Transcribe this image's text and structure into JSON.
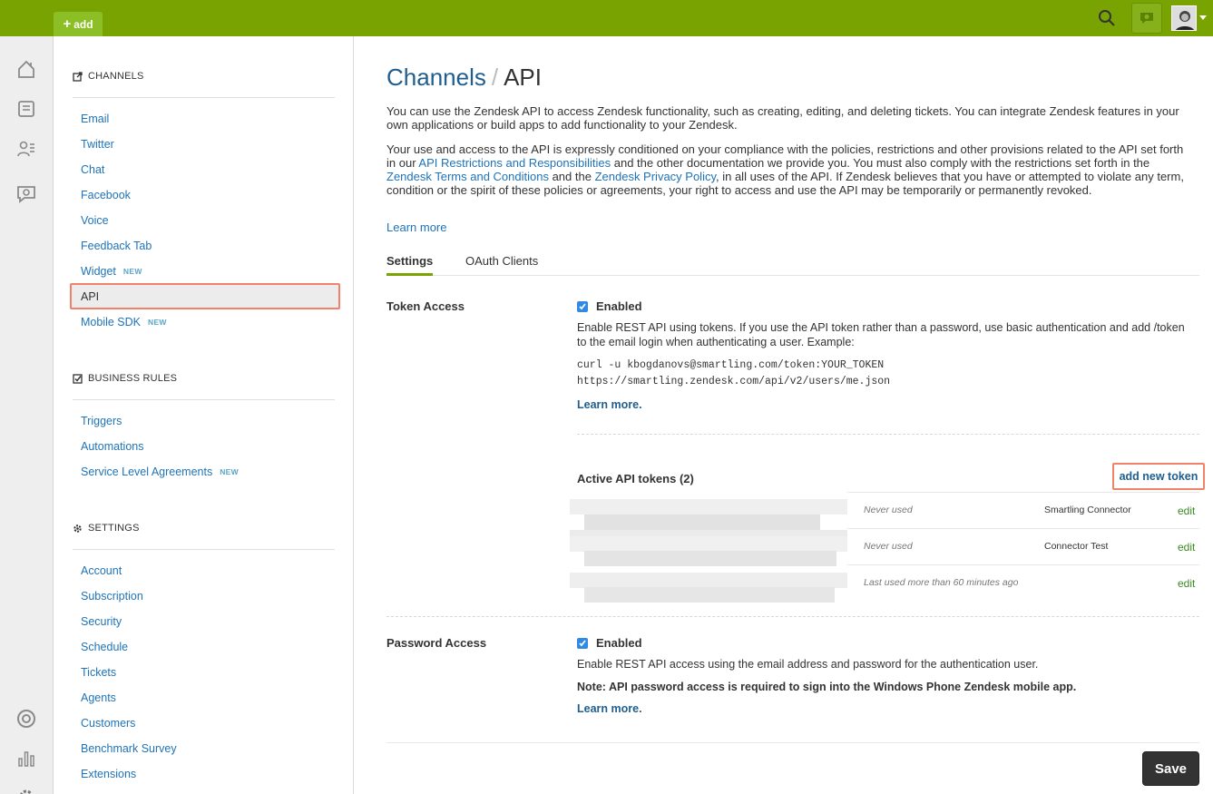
{
  "topbar": {
    "add_label": "add",
    "colors": {
      "bar": "#78a300",
      "add": "#8cbf26"
    },
    "icons": [
      "search-icon",
      "chat-icon",
      "avatar"
    ]
  },
  "rail": {
    "icons": [
      "home-icon",
      "views-icon",
      "customers-icon",
      "chat-icon",
      "help-icon",
      "reporting-icon",
      "admin-gear-icon"
    ]
  },
  "sidebar": {
    "sections": [
      {
        "title": "CHANNELS",
        "icon": "share-icon",
        "items": [
          {
            "label": "Email"
          },
          {
            "label": "Twitter"
          },
          {
            "label": "Chat"
          },
          {
            "label": "Facebook"
          },
          {
            "label": "Voice"
          },
          {
            "label": "Feedback Tab"
          },
          {
            "label": "Widget",
            "badge": "NEW"
          },
          {
            "label": "API",
            "active": true
          },
          {
            "label": "Mobile SDK",
            "badge": "NEW"
          }
        ]
      },
      {
        "title": "BUSINESS RULES",
        "icon": "checkbox-icon",
        "items": [
          {
            "label": "Triggers"
          },
          {
            "label": "Automations"
          },
          {
            "label": "Service Level Agreements",
            "badge": "NEW"
          }
        ]
      },
      {
        "title": "SETTINGS",
        "icon": "gear-icon",
        "items": [
          {
            "label": "Account"
          },
          {
            "label": "Subscription"
          },
          {
            "label": "Security"
          },
          {
            "label": "Schedule"
          },
          {
            "label": "Tickets"
          },
          {
            "label": "Agents"
          },
          {
            "label": "Customers"
          },
          {
            "label": "Benchmark Survey"
          },
          {
            "label": "Extensions"
          }
        ]
      }
    ]
  },
  "main": {
    "breadcrumb_parent": "Channels",
    "breadcrumb_sep": "/",
    "breadcrumb_current": "API",
    "intro": "You can use the Zendesk API to access Zendesk functionality, such as creating, editing, and deleting tickets. You can integrate Zendesk features in your own applications or build apps to add functionality to your Zendesk.",
    "policy": {
      "p1": "Your use and access to the API is expressly conditioned on your compliance with the policies, restrictions and other provisions related to the API set forth in our ",
      "link1": "API Restrictions and Responsibilities",
      "p2": " and the other documentation we provide you. You must also comply with the restrictions set forth in the ",
      "link2": "Zendesk Terms and Conditions",
      "p3": " and the ",
      "link3": "Zendesk Privacy Policy",
      "p4": ", in all uses of the API. If Zendesk believes that you have or attempted to violate any term, condition or the spirit of these policies or agreements, your right to access and use the API may be temporarily or permanently revoked."
    },
    "learn_more": "Learn more",
    "tabs": [
      {
        "label": "Settings",
        "active": true
      },
      {
        "label": "OAuth Clients"
      }
    ],
    "token_access": {
      "label": "Token Access",
      "enabled_label": "Enabled",
      "description": "Enable REST API using tokens. If you use the API token rather than a password, use basic authentication and add /token to the email login when authenticating a user. Example:",
      "code_line1": "curl -u kbogdanovs@smartling.com/token:YOUR_TOKEN",
      "code_line2": "https://smartling.zendesk.com/api/v2/users/me.json",
      "learn_more": "Learn more.",
      "tokens_title": "Active API tokens (2)",
      "add_token": "add new token",
      "tokens": [
        {
          "used": "Never used",
          "name": "Smartling Connector",
          "edit": "edit"
        },
        {
          "used": "Never used",
          "name": "Connector Test",
          "edit": "edit"
        },
        {
          "used": "Last used more than 60 minutes ago",
          "name": "",
          "edit": "edit"
        }
      ]
    },
    "password_access": {
      "label": "Password Access",
      "enabled_label": "Enabled",
      "description": "Enable REST API access using the email address and password for the authentication user.",
      "note": "Note: API password access is required to sign into the Windows Phone Zendesk mobile app.",
      "learn_more": "Learn more."
    },
    "save_label": "Save"
  }
}
